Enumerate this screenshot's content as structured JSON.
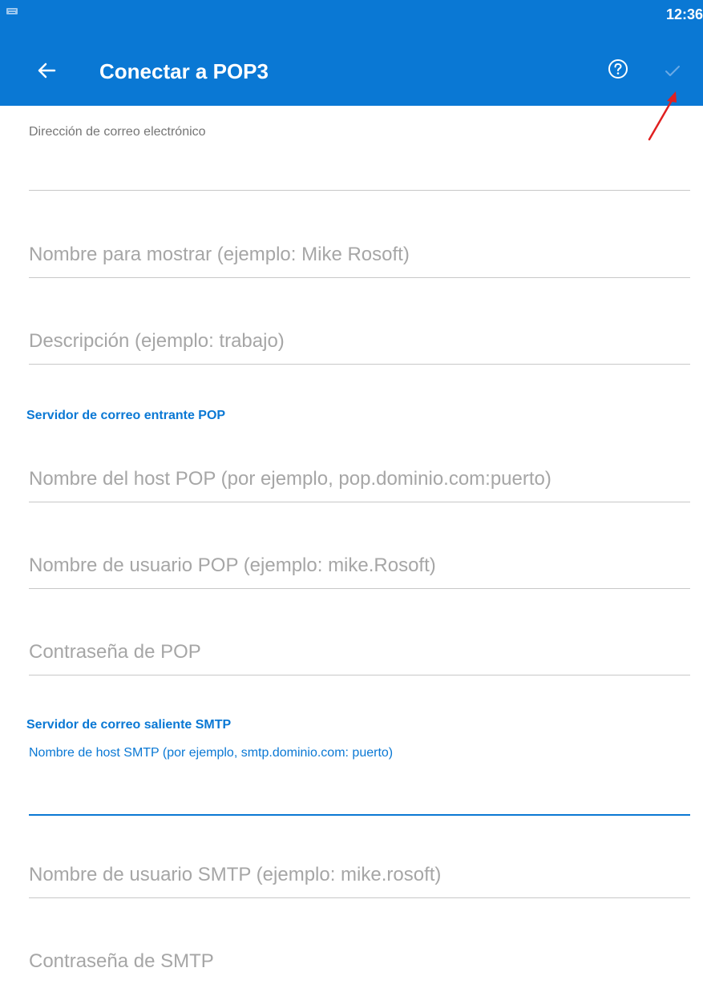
{
  "status_bar": {
    "time": "12:36"
  },
  "app_bar": {
    "title": "Conectar a POP3",
    "icons": {
      "back": "arrow-left-icon",
      "help": "help-circle-icon",
      "confirm": "check-icon"
    }
  },
  "form": {
    "email": {
      "label": "Dirección de correo electrónico",
      "value": ""
    },
    "display_name": {
      "placeholder": "Nombre para mostrar (ejemplo: Mike Rosoft)",
      "value": ""
    },
    "description": {
      "placeholder": "Descripción (ejemplo: trabajo)",
      "value": ""
    },
    "incoming_section": "Servidor de correo entrante POP",
    "pop_host": {
      "placeholder": "Nombre del host POP (por ejemplo, pop.dominio.com:puerto)",
      "value": ""
    },
    "pop_user": {
      "placeholder": "Nombre de usuario POP (ejemplo: mike.Rosoft)",
      "value": ""
    },
    "pop_password": {
      "placeholder": "Contraseña de POP",
      "value": ""
    },
    "outgoing_section": "Servidor de correo saliente SMTP",
    "smtp_host": {
      "label": "Nombre de host SMTP (por ejemplo, smtp.dominio.com: puerto)",
      "value": ""
    },
    "smtp_user": {
      "placeholder": "Nombre de usuario SMTP (ejemplo: mike.rosoft)",
      "value": ""
    },
    "smtp_password": {
      "placeholder": "Contraseña de SMTP",
      "value": ""
    }
  },
  "colors": {
    "accent": "#0a78d4",
    "annotation": "#e02020",
    "placeholder": "#a6a6a6",
    "divider": "#c8c8c8"
  }
}
